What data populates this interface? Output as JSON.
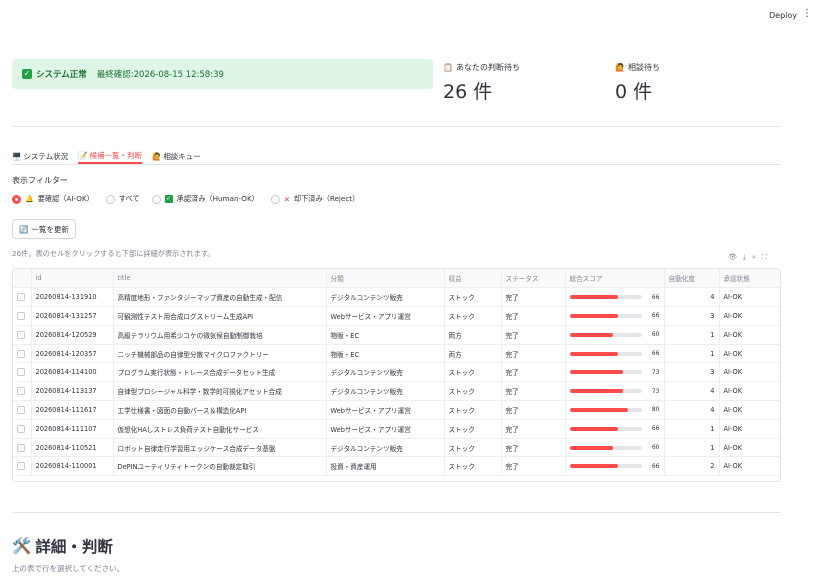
{
  "toolbar": {
    "deploy_label": "Deploy",
    "menu_icon": "kebab-menu-icon"
  },
  "status": {
    "ok_label": "システム正常",
    "last_check": "最終確認:2026-08-15 12:58:39"
  },
  "metrics": [
    {
      "icon": "clipboard-icon",
      "label": "あなたの判断待ち",
      "value": "26 件"
    },
    {
      "icon": "person-raising-hand-icon",
      "label": "相談待ち",
      "value": "0 件"
    }
  ],
  "tabs": [
    {
      "icon": "monitor-icon",
      "label": "システム状況",
      "active": false
    },
    {
      "icon": "memo-icon",
      "label": "候補一覧・判断",
      "active": true
    },
    {
      "icon": "person-raising-hand-icon",
      "label": "相談キュー",
      "active": false
    }
  ],
  "filter": {
    "label": "表示フィルター",
    "options": [
      {
        "icon": "bell-icon",
        "label": "要確認（AI-OK）",
        "selected": true
      },
      {
        "icon": "",
        "label": "すべて",
        "selected": false
      },
      {
        "icon": "check-icon",
        "label": "承認済み（Human-OK）",
        "selected": false
      },
      {
        "icon": "x-icon",
        "label": "却下済み（Reject）",
        "selected": false
      }
    ]
  },
  "refresh_label": "一覧を更新",
  "hint": "26件。表のセルをクリックすると下部に詳細が表示されます。",
  "table": {
    "columns": [
      "id",
      "title",
      "分類",
      "収益",
      "ステータス",
      "総合スコア",
      "自動化度",
      "承認状態"
    ],
    "rows": [
      {
        "id": "20260814-131910",
        "title": "高精度地形・ファンタジーマップ資産の自動生成・配信",
        "category": "デジタルコンテンツ販売",
        "revenue": "ストック",
        "status": "完了",
        "score": 66,
        "automation": 4,
        "approval": "AI-OK"
      },
      {
        "id": "20260814-131257",
        "title": "可観測性テスト用合成ログストリーム生成API",
        "category": "Webサービス・アプリ運営",
        "revenue": "ストック",
        "status": "完了",
        "score": 66,
        "automation": 3,
        "approval": "AI-OK"
      },
      {
        "id": "20260814-120529",
        "title": "高級テラリウム用希少コケの微気候自動制御栽培",
        "category": "物販・EC",
        "revenue": "両方",
        "status": "完了",
        "score": 60,
        "automation": 1,
        "approval": "AI-OK"
      },
      {
        "id": "20260814-120357",
        "title": "ニッチ機械部品の自律型分散マイクロファクトリー",
        "category": "物販・EC",
        "revenue": "両方",
        "status": "完了",
        "score": 66,
        "automation": 1,
        "approval": "AI-OK"
      },
      {
        "id": "20260814-114100",
        "title": "プログラム実行状態・トレース合成データセット生成",
        "category": "デジタルコンテンツ販売",
        "revenue": "ストック",
        "status": "完了",
        "score": 73,
        "automation": 3,
        "approval": "AI-OK"
      },
      {
        "id": "20260814-113137",
        "title": "自律型プロシージャル科学・数学的可視化アセット合成",
        "category": "デジタルコンテンツ販売",
        "revenue": "ストック",
        "status": "完了",
        "score": 73,
        "automation": 4,
        "approval": "AI-OK"
      },
      {
        "id": "20260814-111617",
        "title": "工学仕様書・図面の自動パース＆構造化API",
        "category": "Webサービス・アプリ運営",
        "revenue": "ストック",
        "status": "完了",
        "score": 80,
        "automation": 4,
        "approval": "AI-OK"
      },
      {
        "id": "20260814-111107",
        "title": "仮想化HAしストレス負荷テスト自動化サービス",
        "category": "Webサービス・アプリ運営",
        "revenue": "ストック",
        "status": "完了",
        "score": 66,
        "automation": 1,
        "approval": "AI-OK"
      },
      {
        "id": "20260814-110521",
        "title": "ロボット自律走行学習用エッジケース合成データ基盤",
        "category": "デジタルコンテンツ販売",
        "revenue": "ストック",
        "status": "完了",
        "score": 60,
        "automation": 1,
        "approval": "AI-OK"
      },
      {
        "id": "20260814-110001",
        "title": "DePINユーティリティトークンの自動裁定取引",
        "category": "投資・資産運用",
        "revenue": "ストック",
        "status": "完了",
        "score": 66,
        "automation": 2,
        "approval": "AI-OK"
      }
    ]
  },
  "detail": {
    "title": "詳細・判断",
    "hint": "上の表で行を選択してください。"
  }
}
